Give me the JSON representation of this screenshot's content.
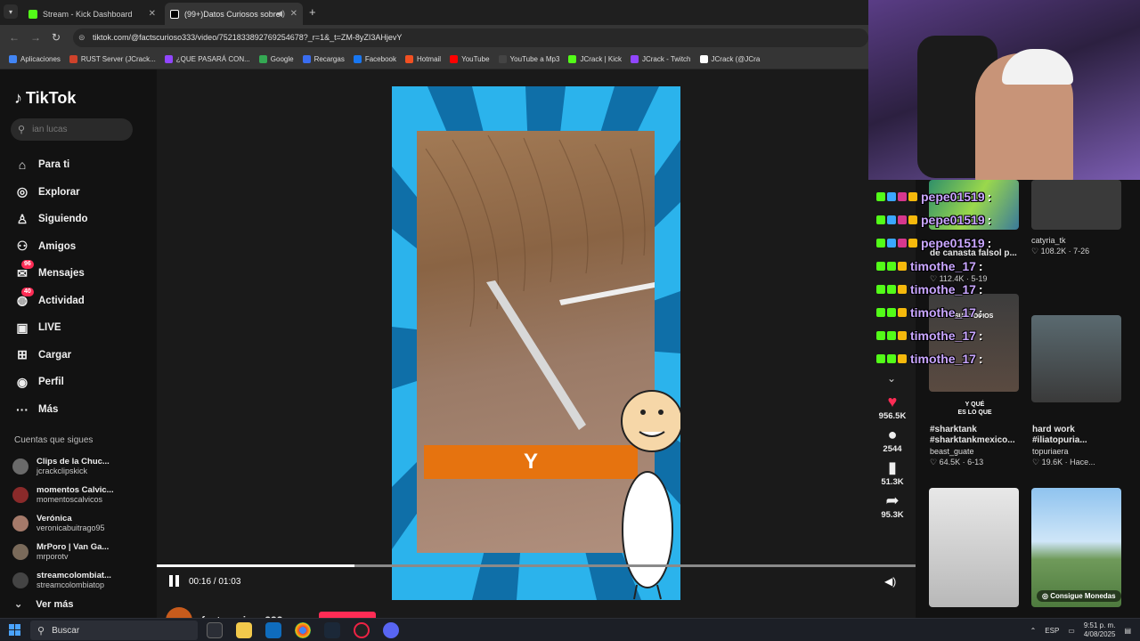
{
  "browser": {
    "tabs": [
      {
        "label": "Stream - Kick Dashboard",
        "color": "#53fc18"
      },
      {
        "label": "(99+)Datos Curiosos sobre",
        "color": "#ffffff"
      }
    ],
    "url": "tiktok.com/@factscurioso333/video/7521833892769254678?_r=1&_t=ZM-8yZI3AHjevY",
    "bookmarks": [
      {
        "label": "Aplicaciones",
        "color": "#4285f4"
      },
      {
        "label": "RUST Server (JCrack...",
        "color": "#ce422b"
      },
      {
        "label": "¿QUE PASARÁ CON...",
        "color": "#9146ff"
      },
      {
        "label": "Google",
        "color": "#34a853"
      },
      {
        "label": "Recargas",
        "color": "#3a6df0"
      },
      {
        "label": "Facebook",
        "color": "#1877f2"
      },
      {
        "label": "Hotmail",
        "color": "#f25022"
      },
      {
        "label": "YouTube",
        "color": "#ff0000"
      },
      {
        "label": "YouTube a Mp3",
        "color": "#444"
      },
      {
        "label": "JCrack | Kick",
        "color": "#53fc18"
      },
      {
        "label": "JCrack - Twitch",
        "color": "#9146ff"
      },
      {
        "label": "JCrack (@JCra",
        "color": "#ffffff"
      }
    ]
  },
  "tiktok": {
    "logo": "TikTok",
    "search_placeholder": "ian lucas",
    "nav": [
      {
        "label": "Para ti",
        "icon": "home-icon",
        "glyph": "⌂"
      },
      {
        "label": "Explorar",
        "icon": "compass-icon",
        "glyph": "◎"
      },
      {
        "label": "Siguiendo",
        "icon": "following-icon",
        "glyph": "♙"
      },
      {
        "label": "Amigos",
        "icon": "friends-icon",
        "glyph": "⚇"
      },
      {
        "label": "Mensajes",
        "icon": "messages-icon",
        "glyph": "✉",
        "badge": "96"
      },
      {
        "label": "Actividad",
        "icon": "activity-icon",
        "glyph": "◍",
        "badge": "40"
      },
      {
        "label": "LIVE",
        "icon": "live-icon",
        "glyph": "▣"
      },
      {
        "label": "Cargar",
        "icon": "upload-icon",
        "glyph": "⊞"
      },
      {
        "label": "Perfil",
        "icon": "profile-icon",
        "glyph": "◉"
      },
      {
        "label": "Más",
        "icon": "more-icon",
        "glyph": "···"
      }
    ],
    "following_title": "Cuentas que sigues",
    "following": [
      {
        "name": "Clips de la Chuc...",
        "handle": "jcrackclipskick"
      },
      {
        "name": "momentos Calvic...",
        "handle": "momentoscalvicos"
      },
      {
        "name": "Verónica",
        "handle": "veronicabuitrago95"
      },
      {
        "name": "MrPoro | Van Ga...",
        "handle": "mrporotv"
      },
      {
        "name": "streamcolombiat...",
        "handle": "streamcolombiatop"
      }
    ],
    "see_more": "Ver más"
  },
  "player": {
    "caption": "Y",
    "time": "00:16 / 01:03",
    "progress": 0.26,
    "author": "factscurioso333"
  },
  "actions": {
    "likes": "956.5K",
    "comments": "2544",
    "saves": "51.3K",
    "shares": "95.3K"
  },
  "recommended": [
    {
      "title": "",
      "user": "catyria_tk",
      "stats": "♡ 108.2K · 7-26"
    },
    {
      "title": "de canasta falsol p...",
      "user": "",
      "stats": "♡ 112.4K · 5-19"
    },
    {
      "title": "#sharktank #sharktankmexico...",
      "user": "beast_guate",
      "stats": "♡ 64.5K · 6-13"
    },
    {
      "title": "hard work #iliatopuria...",
      "user": "topuriaera",
      "stats": "♡ 19.6K · Hace..."
    },
    {
      "title": "",
      "user": "",
      "stats": ""
    },
    {
      "title": "",
      "user": "",
      "stats": "Consigue Monedas"
    }
  ],
  "thumb_text": {
    "yque": "Y QUÉ",
    "eslo": "ES LO QUE",
    "socios": "SUS SOCIOS"
  },
  "chat": [
    {
      "user": "pepe01519"
    },
    {
      "user": "pepe01519"
    },
    {
      "user": "pepe01519"
    },
    {
      "user": "timothe_17"
    },
    {
      "user": "timothe_17"
    },
    {
      "user": "timothe_17"
    },
    {
      "user": "timothe_17"
    },
    {
      "user": "timothe_17"
    }
  ],
  "taskbar": {
    "search": "Buscar",
    "lang": "ESP",
    "time": "9:51 p. m.",
    "date": "4/08/2025"
  }
}
